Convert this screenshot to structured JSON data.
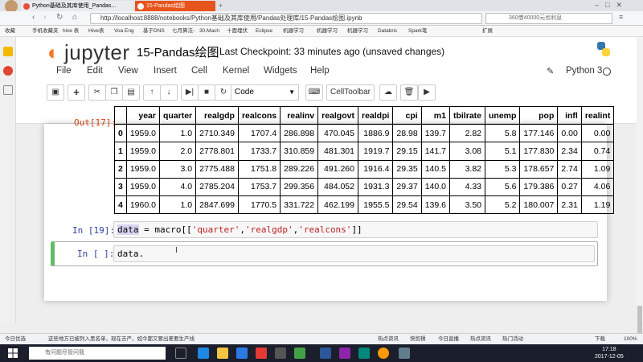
{
  "browser": {
    "tabs": [
      {
        "label": "Python基础及其库使用_Pandas..."
      },
      {
        "label": "15-Pandas绘图"
      }
    ],
    "url": "http://localhost:8888/notebooks/Python基础及其库使用/Pandas处理库/15-Pandas绘图.ipynb",
    "search_placeholder": "360借40000元也利息",
    "bookmarks": [
      "收藏",
      "手机收藏夹",
      "hive 表",
      "Hive表",
      "Voa Eng",
      "基于DNS",
      "七月算法-",
      "30.Mach",
      "十面埋伏",
      "Eclipse",
      "机器学习",
      "机器学习",
      "机器学习",
      "Databric",
      "Spark笔",
      "扩展"
    ]
  },
  "jupyter": {
    "logo_text": "jupyter",
    "notebook_name": "15-Pandas绘图",
    "checkpoint": "Last Checkpoint: 33 minutes ago (unsaved changes)",
    "menu": [
      "File",
      "Edit",
      "View",
      "Insert",
      "Cell",
      "Kernel",
      "Widgets",
      "Help"
    ],
    "kernel": "Python 3",
    "cell_type": "Code",
    "celltoolbar_label": "CellToolbar"
  },
  "output": {
    "prompt": "Out[17]:",
    "columns": [
      "",
      "year",
      "quarter",
      "realgdp",
      "realcons",
      "realinv",
      "realgovt",
      "realdpi",
      "cpi",
      "m1",
      "tbilrate",
      "unemp",
      "pop",
      "infl",
      "realint"
    ],
    "rows": [
      [
        "0",
        "1959.0",
        "1.0",
        "2710.349",
        "1707.4",
        "286.898",
        "470.045",
        "1886.9",
        "28.98",
        "139.7",
        "2.82",
        "5.8",
        "177.146",
        "0.00",
        "0.00"
      ],
      [
        "1",
        "1959.0",
        "2.0",
        "2778.801",
        "1733.7",
        "310.859",
        "481.301",
        "1919.7",
        "29.15",
        "141.7",
        "3.08",
        "5.1",
        "177.830",
        "2.34",
        "0.74"
      ],
      [
        "2",
        "1959.0",
        "3.0",
        "2775.488",
        "1751.8",
        "289.226",
        "491.260",
        "1916.4",
        "29.35",
        "140.5",
        "3.82",
        "5.3",
        "178.657",
        "2.74",
        "1.09"
      ],
      [
        "3",
        "1959.0",
        "4.0",
        "2785.204",
        "1753.7",
        "299.356",
        "484.052",
        "1931.3",
        "29.37",
        "140.0",
        "4.33",
        "5.6",
        "179.386",
        "0.27",
        "4.06"
      ],
      [
        "4",
        "1960.0",
        "1.0",
        "2847.699",
        "1770.5",
        "331.722",
        "462.199",
        "1955.5",
        "29.54",
        "139.6",
        "3.50",
        "5.2",
        "180.007",
        "2.31",
        "1.19"
      ]
    ]
  },
  "cells": {
    "cell1_prompt": "In [19]:",
    "cell1_var": "data",
    "cell1_op": " = macro[[",
    "cell1_s1": "'quarter'",
    "cell1_s2": "'realgdp'",
    "cell1_s3": "'realcons'",
    "cell1_end": "]]",
    "comma": ",",
    "cell2_prompt": "In [ ]:",
    "cell2_code": "data."
  },
  "statusbar": {
    "left": "今日优选",
    "news": "这些地方已被列入黑名单，现在去严，如今都又要出差要生产线",
    "items": [
      "热点资讯",
      "快剪辑",
      "今日直播",
      "热点资讯",
      "热门活动",
      "下载",
      "100%"
    ]
  },
  "taskbar": {
    "search_placeholder": "有问题尽管问我",
    "time": "17:18",
    "date": "2017-12-05"
  }
}
